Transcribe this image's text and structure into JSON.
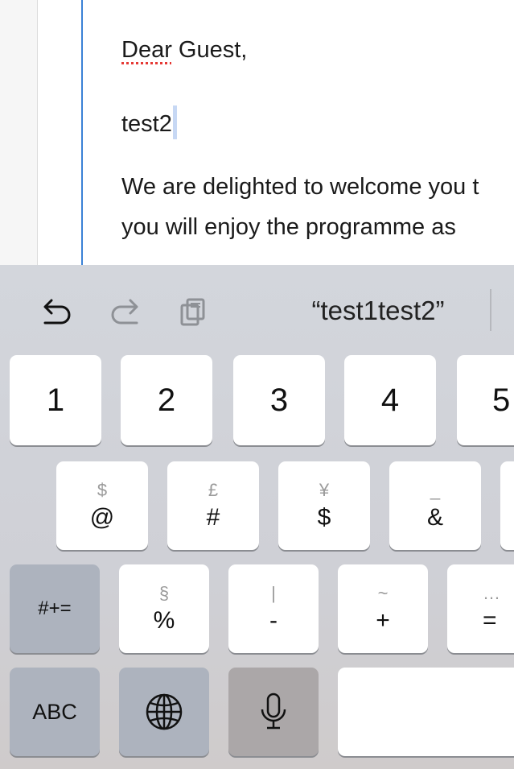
{
  "document": {
    "lines": [
      "Dear Guest,",
      "test2",
      "We are delighted to welcome you t",
      "you will enjoy the programme as"
    ],
    "misspelled_word": "Dear",
    "first_line_rest": " Guest,"
  },
  "toolbar": {
    "undo_icon": "undo-icon",
    "redo_icon": "redo-icon",
    "paste_icon": "paste-icon",
    "suggestion": "“test1test2”"
  },
  "keyboard": {
    "row1": [
      "1",
      "2",
      "3",
      "4",
      "5"
    ],
    "row2": [
      {
        "main": "@",
        "sub": "$"
      },
      {
        "main": "#",
        "sub": "£"
      },
      {
        "main": "$",
        "sub": "¥"
      },
      {
        "main": "&",
        "sub": "_"
      },
      {
        "main": "",
        "sub": ""
      }
    ],
    "row3": [
      {
        "main": "#+=",
        "sub": ""
      },
      {
        "main": "%",
        "sub": "§"
      },
      {
        "main": "-",
        "sub": "|"
      },
      {
        "main": "+",
        "sub": "~"
      },
      {
        "main": "=",
        "sub": "…"
      }
    ],
    "row4": {
      "abc_label": "ABC",
      "globe_icon": "globe-icon",
      "mic_icon": "microphone-icon",
      "space_label": ""
    }
  },
  "colors": {
    "accent_line": "#3b82d6",
    "spell_underline": "#e53935",
    "key_dark": "#adb3be"
  }
}
